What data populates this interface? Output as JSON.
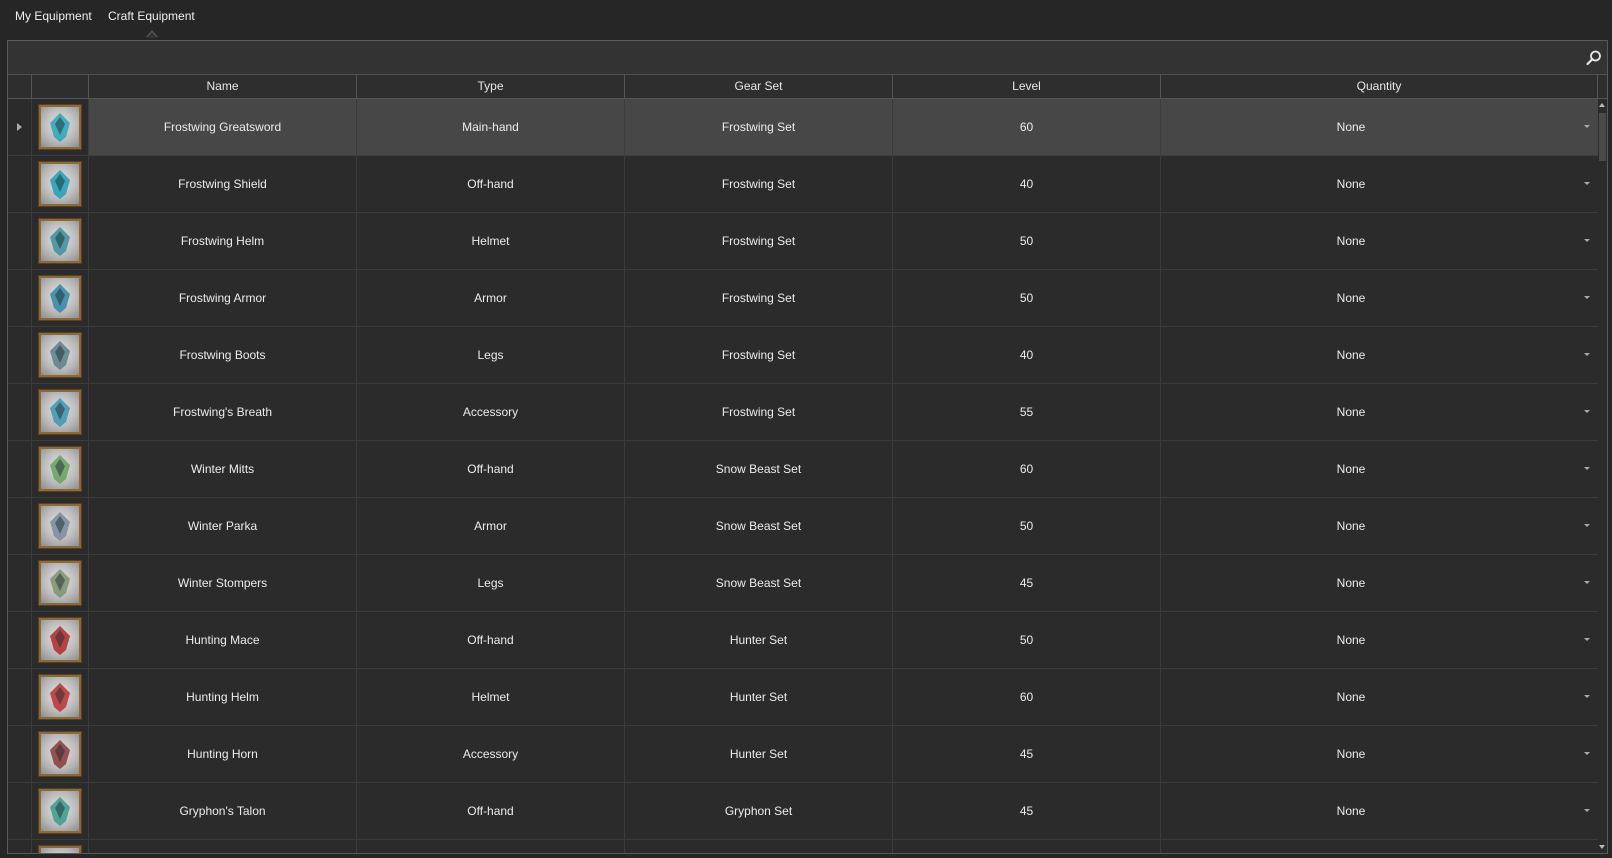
{
  "tabs": [
    {
      "label": "My Equipment"
    },
    {
      "label": "Craft Equipment"
    }
  ],
  "columns": {
    "name": "Name",
    "type": "Type",
    "gear_set": "Gear Set",
    "level": "Level",
    "quantity": "Quantity"
  },
  "colors": {
    "background": "#262626",
    "selected_row": "#474747",
    "icon_border": "#8a6a3a"
  },
  "rows": [
    {
      "name": "Frostwing Greatsword",
      "type": "Main-hand",
      "gear_set": "Frostwing Set",
      "level": "60",
      "quantity": "None",
      "icon": "frost-sword-icon",
      "selected": true
    },
    {
      "name": "Frostwing Shield",
      "type": "Off-hand",
      "gear_set": "Frostwing Set",
      "level": "40",
      "quantity": "None",
      "icon": "frost-shield-icon"
    },
    {
      "name": "Frostwing Helm",
      "type": "Helmet",
      "gear_set": "Frostwing Set",
      "level": "50",
      "quantity": "None",
      "icon": "frost-helm-icon"
    },
    {
      "name": "Frostwing Armor",
      "type": "Armor",
      "gear_set": "Frostwing Set",
      "level": "50",
      "quantity": "None",
      "icon": "frost-armor-icon"
    },
    {
      "name": "Frostwing Boots",
      "type": "Legs",
      "gear_set": "Frostwing Set",
      "level": "40",
      "quantity": "None",
      "icon": "frost-boots-icon"
    },
    {
      "name": "Frostwing's Breath",
      "type": "Accessory",
      "gear_set": "Frostwing Set",
      "level": "55",
      "quantity": "None",
      "icon": "frost-amulet-icon"
    },
    {
      "name": "Winter Mitts",
      "type": "Off-hand",
      "gear_set": "Snow Beast Set",
      "level": "60",
      "quantity": "None",
      "icon": "mitts-icon"
    },
    {
      "name": "Winter Parka",
      "type": "Armor",
      "gear_set": "Snow Beast Set",
      "level": "50",
      "quantity": "None",
      "icon": "parka-icon"
    },
    {
      "name": "Winter Stompers",
      "type": "Legs",
      "gear_set": "Snow Beast Set",
      "level": "45",
      "quantity": "None",
      "icon": "stompers-icon"
    },
    {
      "name": "Hunting Mace",
      "type": "Off-hand",
      "gear_set": "Hunter Set",
      "level": "50",
      "quantity": "None",
      "icon": "mace-icon"
    },
    {
      "name": "Hunting Helm",
      "type": "Helmet",
      "gear_set": "Hunter Set",
      "level": "60",
      "quantity": "None",
      "icon": "hunter-helm-icon"
    },
    {
      "name": "Hunting Horn",
      "type": "Accessory",
      "gear_set": "Hunter Set",
      "level": "45",
      "quantity": "None",
      "icon": "horn-icon"
    },
    {
      "name": "Gryphon's Talon",
      "type": "Off-hand",
      "gear_set": "Gryphon Set",
      "level": "45",
      "quantity": "None",
      "icon": "talon-icon"
    }
  ]
}
